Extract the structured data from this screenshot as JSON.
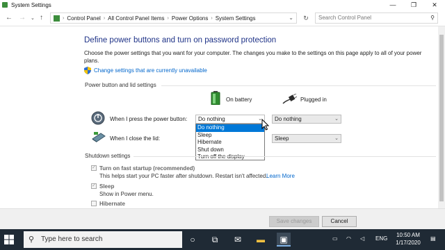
{
  "window": {
    "title": "System Settings",
    "minimize": "—",
    "maximize": "❐",
    "close": "✕"
  },
  "address": {
    "crumbs": [
      "Control Panel",
      "All Control Panel Items",
      "Power Options",
      "System Settings"
    ],
    "search_placeholder": "Search Control Panel"
  },
  "page": {
    "heading": "Define power buttons and turn on password protection",
    "description": "Choose the power settings that you want for your computer. The changes you make to the settings on this page apply to all of your power plans.",
    "change_link": "Change settings that are currently unavailable"
  },
  "power_section": {
    "title": "Power button and lid settings",
    "col_battery": "On battery",
    "col_plugged": "Plugged in",
    "power_button_label": "When I press the power button:",
    "lid_label": "When I close the lid:",
    "power_battery_value": "Do nothing",
    "power_plugged_value": "Do nothing",
    "lid_plugged_value": "Sleep"
  },
  "dropdown_options": [
    "Do nothing",
    "Sleep",
    "Hibernate",
    "Shut down",
    "Turn off the display"
  ],
  "shutdown_section": {
    "title": "Shutdown settings",
    "fast_startup_label": "Turn on fast startup (recommended)",
    "fast_startup_desc": "This helps start your PC faster after shutdown. Restart isn't affected.",
    "learn_more": "Learn More",
    "sleep_label": "Sleep",
    "sleep_desc": "Show in Power menu.",
    "hibernate_label": "Hibernate"
  },
  "buttons": {
    "save": "Save changes",
    "cancel": "Cancel"
  },
  "taskbar": {
    "search_placeholder": "Type here to search",
    "language": "ENG",
    "time": "10:50 AM",
    "date": "1/17/2020"
  },
  "colors": {
    "heading": "#1e3287",
    "link": "#0066cc",
    "selection": "#0078d7",
    "taskbar": "#1f2a35"
  }
}
